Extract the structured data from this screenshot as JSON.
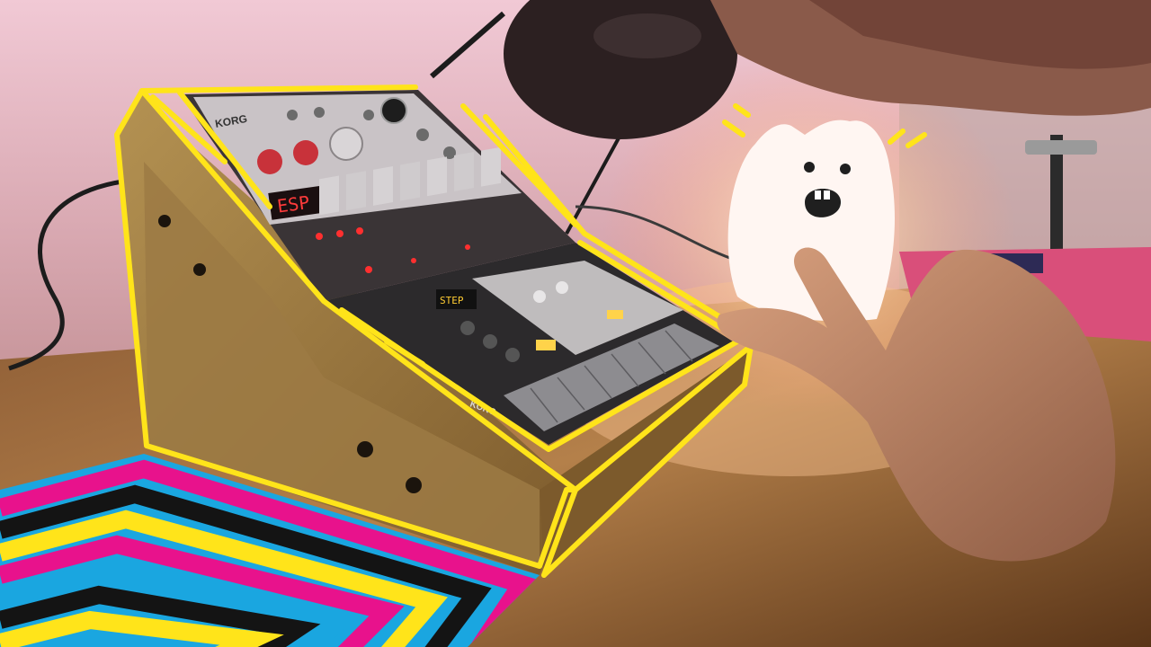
{
  "scene": {
    "description_tags": [
      "wall",
      "desk",
      "synth-stand",
      "drum-machine",
      "bass-synth",
      "cable",
      "microphone",
      "ghost-lamp",
      "hand",
      "stripe-pattern"
    ],
    "colors": {
      "wall_top": "#e8b9c9",
      "wall_mid": "#d9a7ad",
      "desk": "#b07a45",
      "desk_dark": "#6e4423",
      "outline": "#ffe41a",
      "wood": "#a8854b",
      "ghost": "#fff6f2",
      "ghost_glow": "#ffd9b8",
      "stripe_magenta": "#e8128c",
      "stripe_yellow": "#ffe41a",
      "stripe_cyan": "#1aa6e0",
      "stripe_black": "#141414"
    }
  },
  "devices": {
    "top_unit_display": "ESP",
    "top_unit_logo": "KORG",
    "lower_unit_logo": "KORG",
    "lower_unit_display": "STEP"
  }
}
